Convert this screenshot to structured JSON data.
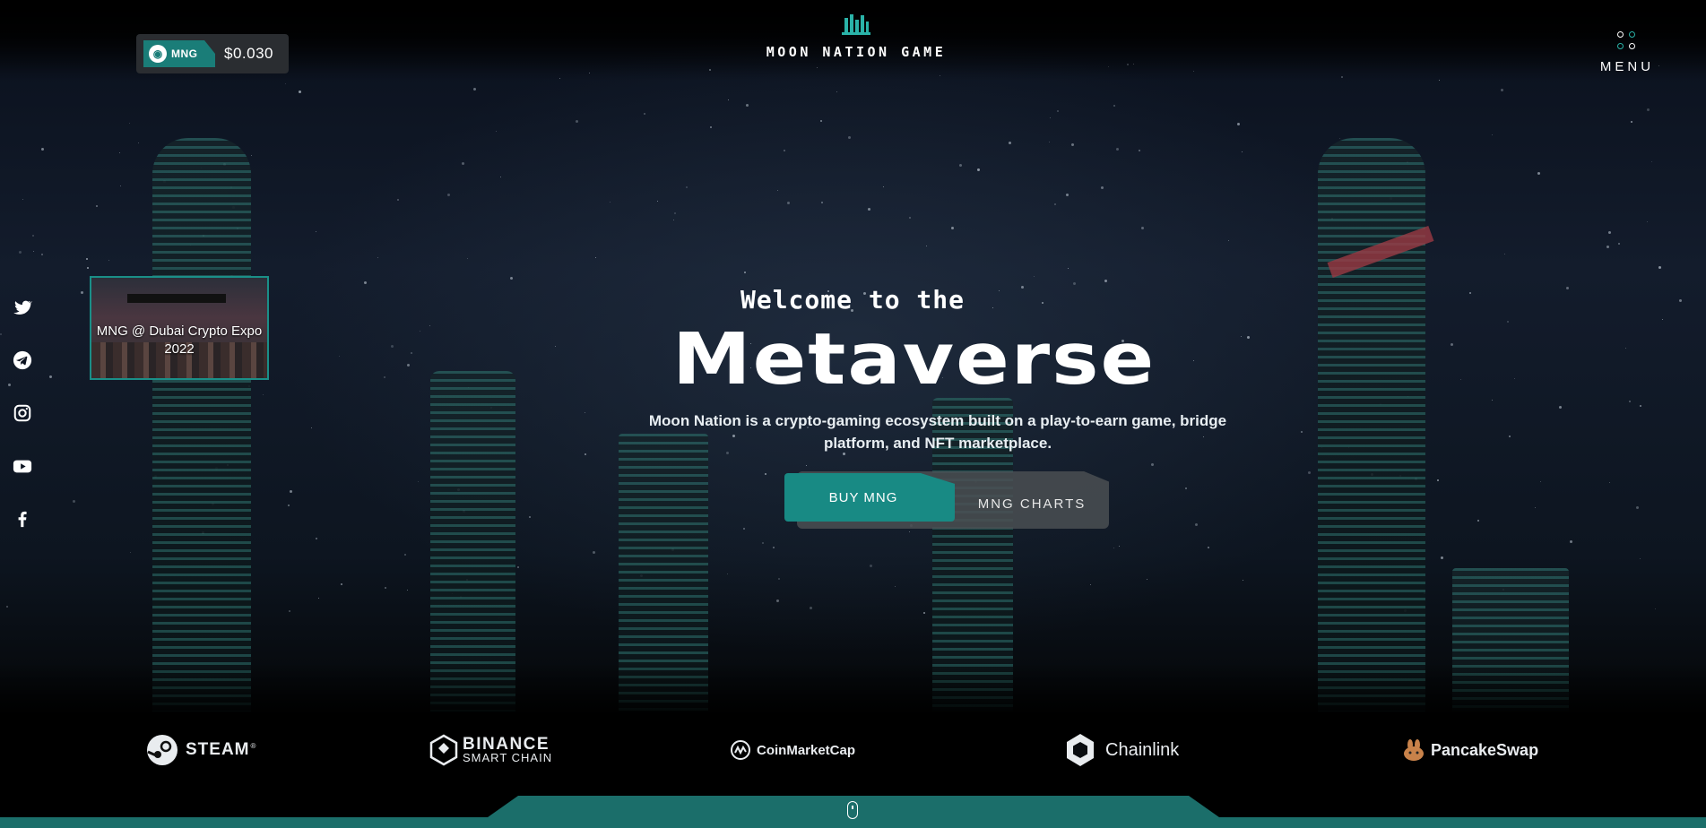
{
  "token": {
    "symbol": "MNG",
    "price": "$0.030"
  },
  "brand": {
    "name": "MOON NATION GAME",
    "accent": "#1a8f88"
  },
  "menu": {
    "label": "MENU"
  },
  "social": [
    "twitter-icon",
    "telegram-icon",
    "instagram-icon",
    "youtube-icon",
    "facebook-icon"
  ],
  "event": {
    "caption": "MNG @ Dubai Crypto Expo 2022"
  },
  "hero": {
    "pretitle": "Welcome to the",
    "title": "Metaverse",
    "description": "Moon Nation is a crypto-gaming ecosystem built on a play-to-earn game, bridge platform, and NFT marketplace."
  },
  "buttons": {
    "buy": "BUY MNG",
    "charts": "MNG CHARTS"
  },
  "partners": {
    "steam": "STEAM",
    "binance_1": "BINANCE",
    "binance_2": "SMART CHAIN",
    "coinmarketcap": "CoinMarketCap",
    "chainlink": "Chainlink",
    "pancakeswap": "PancakeSwap"
  }
}
